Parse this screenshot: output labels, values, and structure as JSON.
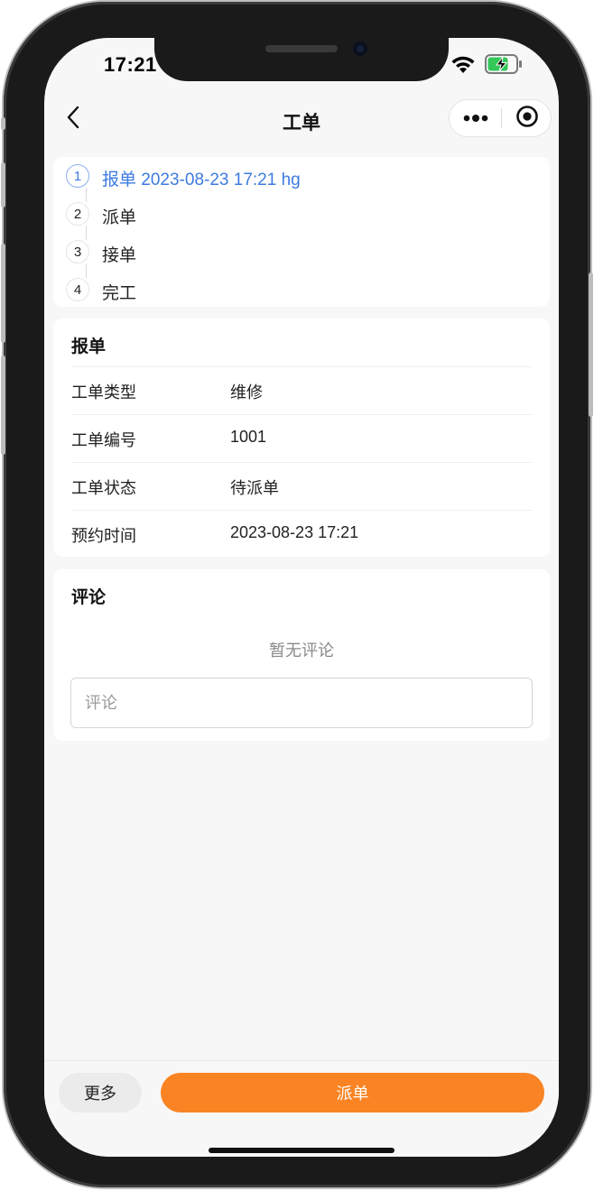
{
  "status_bar": {
    "time": "17:21"
  },
  "navbar": {
    "title": "工单"
  },
  "steps": [
    {
      "num": "1",
      "label": "报单 2023-08-23 17:21 hg",
      "active": true
    },
    {
      "num": "2",
      "label": "派单",
      "active": false
    },
    {
      "num": "3",
      "label": "接单",
      "active": false
    },
    {
      "num": "4",
      "label": "完工",
      "active": false
    }
  ],
  "report": {
    "title": "报单",
    "rows": [
      {
        "label": "工单类型",
        "value": "维修"
      },
      {
        "label": "工单编号",
        "value": "1001"
      },
      {
        "label": "工单状态",
        "value": "待派单"
      },
      {
        "label": "预约时间",
        "value": "2023-08-23 17:21"
      }
    ]
  },
  "comments": {
    "title": "评论",
    "empty_text": "暂无评论",
    "input_placeholder": "评论",
    "input_value": ""
  },
  "bottom": {
    "more_label": "更多",
    "dispatch_label": "派单"
  },
  "colors": {
    "accent": "#fa8424",
    "active_step": "#3c7be0"
  },
  "icons": {
    "back": "chevron-left-icon",
    "more": "more-dots-icon",
    "close": "target-circle-icon",
    "signal": "signal-icon",
    "wifi": "wifi-icon",
    "battery": "battery-charging-icon"
  }
}
